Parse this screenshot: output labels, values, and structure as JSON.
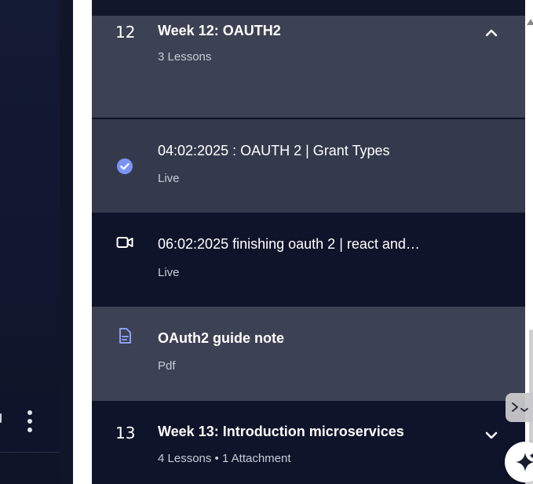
{
  "sections": [
    {
      "number": "12",
      "title": "Week 12: OAUTH2",
      "meta": "3 Lessons",
      "expanded": true,
      "chevron_icon": "chevron-up-icon",
      "lessons": [
        {
          "title": "04:02:2025 : OAUTH 2 | Grant Types",
          "type": "Live",
          "icon": "check-circle-icon",
          "status_color": "#7b93f5"
        },
        {
          "title": "06:02:2025 finishing oauth 2 | react and…",
          "type": "Live",
          "icon": "video-camera-icon"
        },
        {
          "title": "OAuth2 guide note",
          "type": "Pdf",
          "icon": "document-icon",
          "icon_color": "#8aa1f5"
        }
      ]
    },
    {
      "number": "13",
      "title": "Week 13: Introduction microservices",
      "meta": "4 Lessons • 1 Attachment",
      "expanded": false,
      "chevron_icon": "chevron-down-icon"
    }
  ],
  "left_pane": {
    "menu_icon": "kebab-menu-icon"
  },
  "floating": {
    "side_tab_icon": "code-chevrons-icon",
    "assistant_icon": "sparkle-icon"
  },
  "colors": {
    "panel_bg": "#10142a",
    "expanded_header_bg": "#3c4153",
    "completed_row_bg": "#343a4c",
    "accent": "#7b93f5"
  }
}
